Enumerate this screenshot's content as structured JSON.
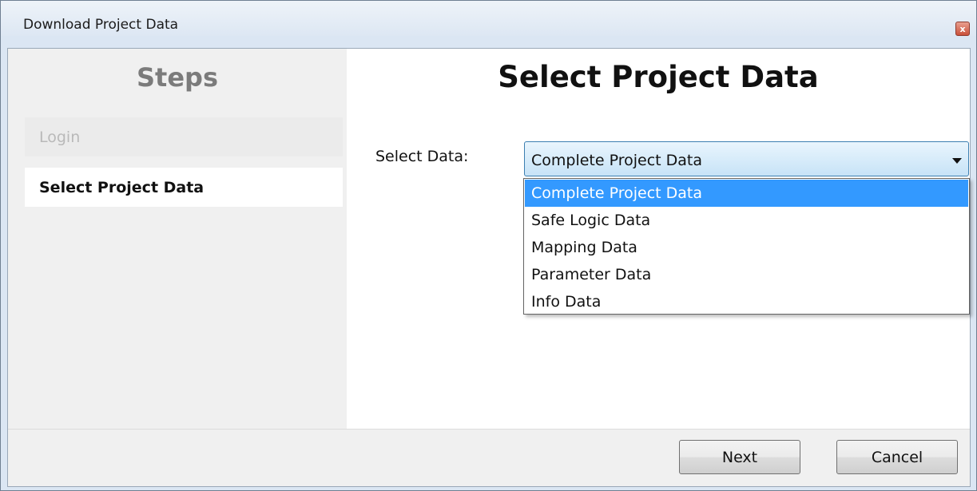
{
  "window": {
    "title": "Download Project Data",
    "close_glyph": "x",
    "close_icon": "close-icon"
  },
  "sidebar": {
    "title": "Steps",
    "steps": [
      {
        "label": "Login",
        "state": "disabled"
      },
      {
        "label": "Select Project Data",
        "state": "current"
      }
    ]
  },
  "main": {
    "title": "Select Project Data",
    "select_label": "Select Data:",
    "select_value": "Complete Project Data",
    "dropdown_open": true,
    "options": [
      {
        "label": "Complete Project Data",
        "selected": true
      },
      {
        "label": "Safe Logic Data",
        "selected": false
      },
      {
        "label": "Mapping Data",
        "selected": false
      },
      {
        "label": "Parameter Data",
        "selected": false
      },
      {
        "label": "Info Data",
        "selected": false
      }
    ]
  },
  "footer": {
    "next_label": "Next",
    "cancel_label": "Cancel"
  },
  "colors": {
    "selection": "#3399ff",
    "combo_border": "#3c7fb1",
    "sidebar_bg": "#f0f0f0",
    "close_button": "#c9503a"
  }
}
